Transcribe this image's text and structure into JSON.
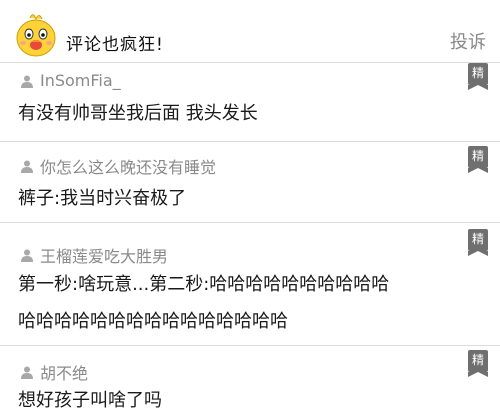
{
  "header": {
    "title": "评论也疯狂!",
    "report_label": "投诉"
  },
  "badge_label": "精",
  "comments": [
    {
      "user": "InSomFia_",
      "text_lines": [
        "有没有帅哥坐我后面 我头发长"
      ]
    },
    {
      "user": "你怎么这么晚还没有睡觉",
      "text_lines": [
        "裤子:我当时兴奋极了"
      ]
    },
    {
      "user": "王榴莲爱吃大胜男",
      "text_lines": [
        "第一秒:啥玩意...第二秒:哈哈哈哈哈哈哈哈哈哈",
        "哈哈哈哈哈哈哈哈哈哈哈哈哈哈哈"
      ]
    },
    {
      "user": "胡不绝",
      "text_lines": [
        "想好孩子叫啥了吗"
      ]
    }
  ],
  "colors": {
    "badge": "#6f6f6f",
    "meta_text": "#8a8a8a",
    "separator": "#dcdcdc"
  },
  "icons": {
    "avatar": "yellow-chick-icon",
    "user": "user-icon",
    "badge": "featured-badge-icon"
  }
}
